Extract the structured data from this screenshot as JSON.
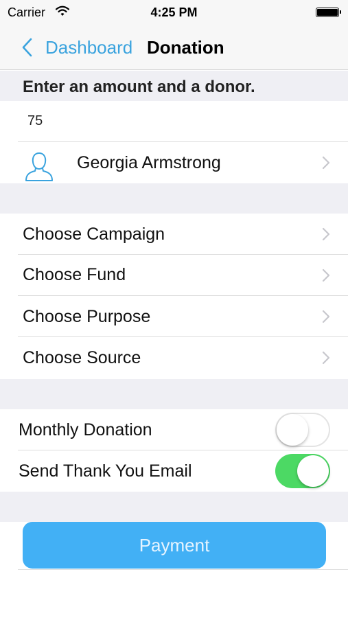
{
  "status_bar": {
    "carrier": "Carrier",
    "time": "4:25 PM",
    "icons": [
      "wifi-icon",
      "battery-icon"
    ]
  },
  "nav": {
    "back_label": "Dashboard",
    "title": "Donation",
    "back_icon": "chevron-left-icon"
  },
  "section_header": "Enter an amount and a donor.",
  "amount": {
    "value": "75",
    "placeholder": ""
  },
  "donor": {
    "name": "Georgia Armstrong",
    "icon": "person-icon"
  },
  "choices": [
    {
      "label": "Choose Campaign"
    },
    {
      "label": "Choose Fund"
    },
    {
      "label": "Choose Purpose"
    },
    {
      "label": "Choose Source"
    }
  ],
  "toggles": [
    {
      "label": "Monthly Donation",
      "on": false
    },
    {
      "label": "Send Thank You Email",
      "on": true
    }
  ],
  "payment_label": "Payment",
  "colors": {
    "accent": "#3aa3de",
    "button": "#42b0f5",
    "switch_on": "#4cd964",
    "group_background": "#efeff4"
  }
}
